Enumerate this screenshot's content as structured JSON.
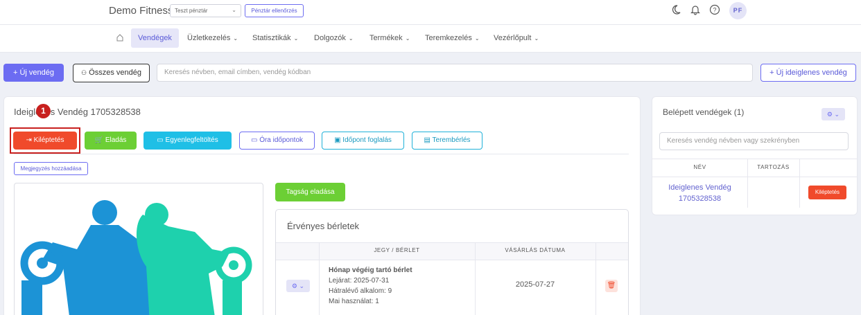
{
  "header": {
    "brand": "Demo Fitness",
    "register_select": "Teszt pénztár",
    "register_check_button": "Pénztár ellenőrzés",
    "avatar_initials": "PF"
  },
  "nav": {
    "items": [
      {
        "label": "Vendégek",
        "active": true
      },
      {
        "label": "Üzletkezelés"
      },
      {
        "label": "Statisztikák"
      },
      {
        "label": "Dolgozók"
      },
      {
        "label": "Termékek"
      },
      {
        "label": "Teremkezelés"
      },
      {
        "label": "Vezérlőpult"
      }
    ]
  },
  "toolbar": {
    "new_guest": "Új vendég",
    "all_guests": "Összes vendég",
    "search_placeholder": "Keresés névben, email címben, vendég kódban",
    "new_temp_guest": "Új ideiglenes vendég"
  },
  "guest": {
    "title": "Ideiglenes Vendég 1705328538",
    "step_badge": "1",
    "actions": {
      "checkout": "Kiléptetés",
      "sale": "Eladás",
      "balance": "Egyenlegfeltöltés",
      "class_times": "Óra időpontok",
      "booking": "Időpont foglalás",
      "room_rental": "Terembérlés"
    },
    "add_note": "Megjegyzés hozzáadása",
    "sell_membership": "Tagság eladása",
    "passes": {
      "title": "Érvényes bérletek",
      "columns": [
        "JEGY / BÉRLET",
        "VÁSÁRLÁS DÁTUMA"
      ],
      "rows": [
        {
          "name": "Hónap végéig tartó bérlet",
          "expiry": "Lejárat: 2025-07-31",
          "remaining": "Hátralévő alkalom: 9",
          "today_usage": "Mai használat: 1",
          "purchase_date": "2025-07-27"
        }
      ]
    }
  },
  "checked_in": {
    "title": "Belépett vendégek (1)",
    "search_placeholder": "Keresés vendég névben vagy szekrényben",
    "columns": [
      "NÉV",
      "TARTOZÁS"
    ],
    "rows": [
      {
        "name_line1": "Ideiglenes Vendég",
        "name_line2": "1705328538",
        "debt": "",
        "action": "Kiléptetés"
      }
    ]
  },
  "colors": {
    "primary": "#6c6cf2",
    "danger": "#f04a2b",
    "success": "#6ccf35",
    "info": "#1fbfe6",
    "highlight": "#c8201e",
    "male_figure": "#1c93d6",
    "female_figure": "#1ed1ad"
  }
}
